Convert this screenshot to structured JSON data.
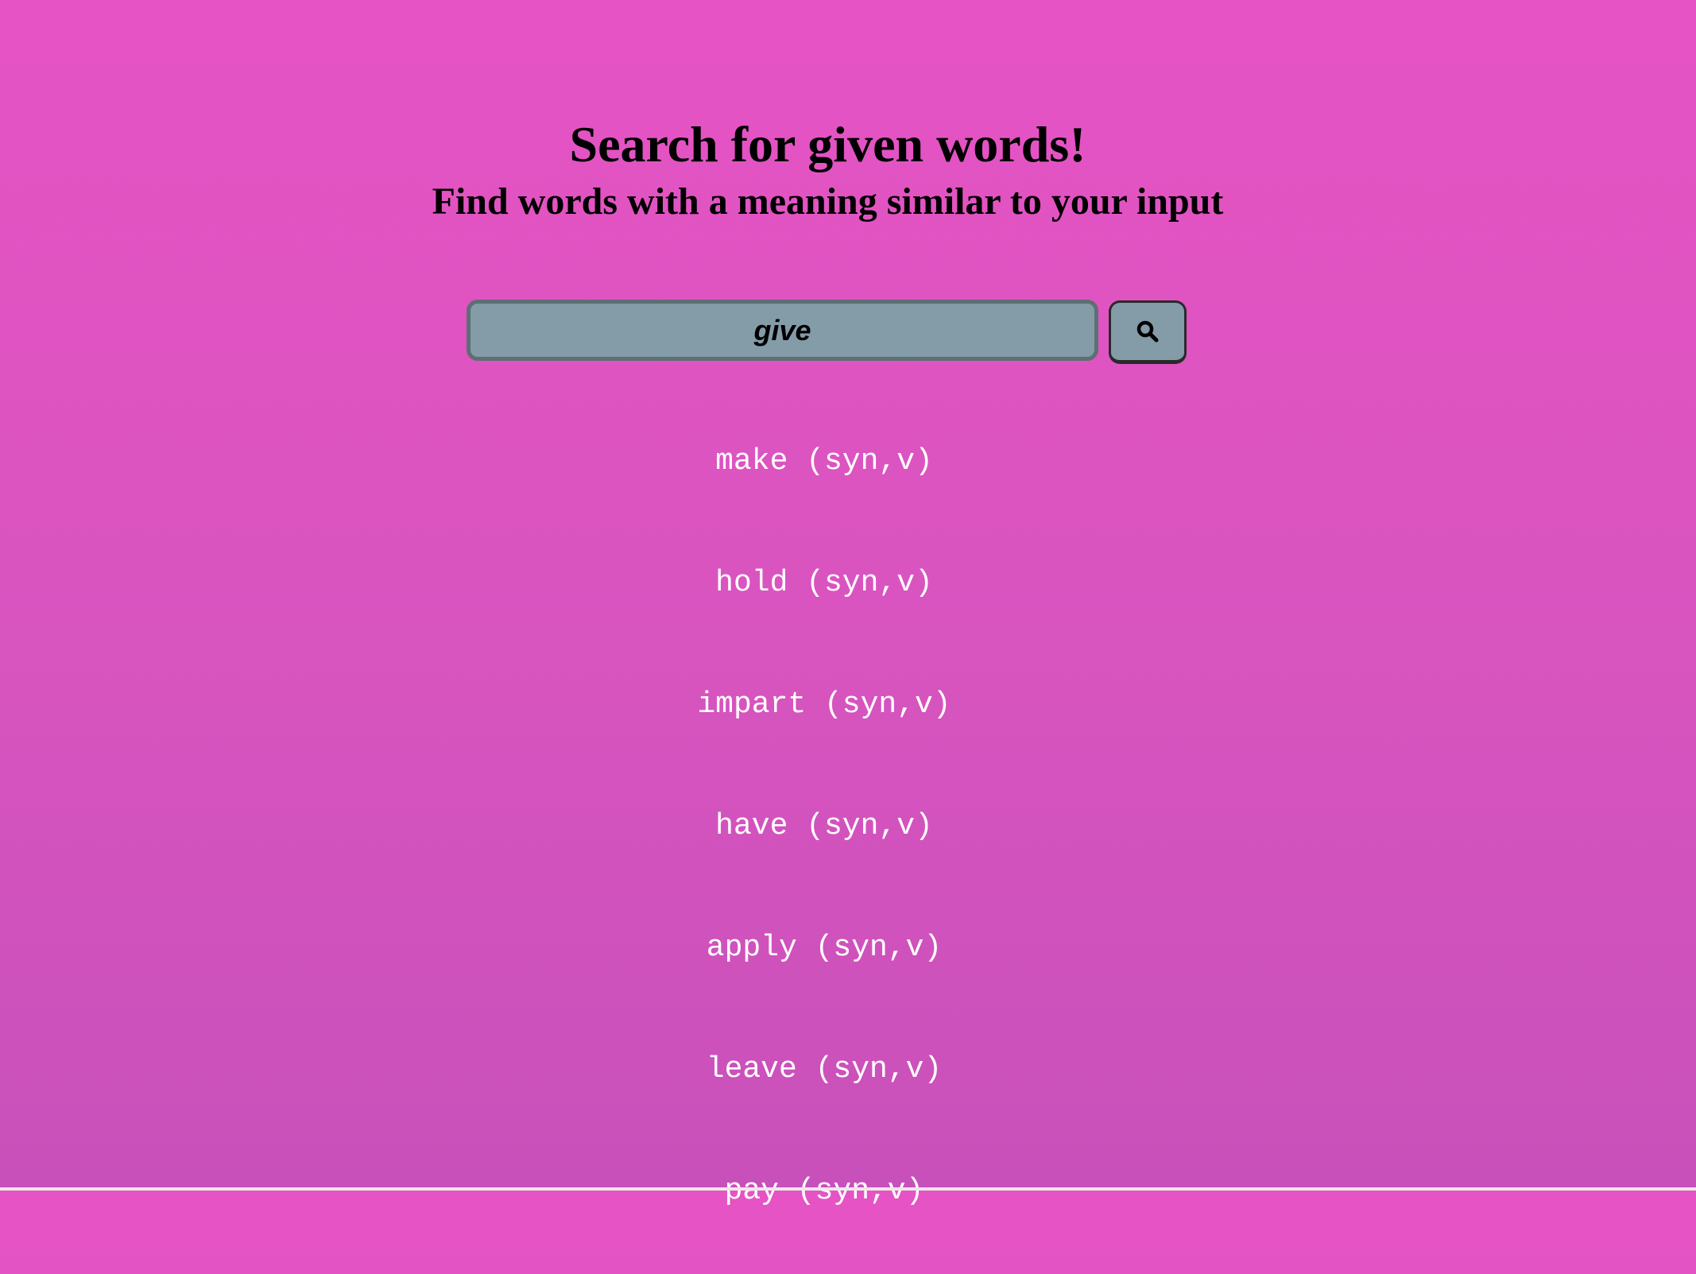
{
  "header": {
    "title": "Search for given words!",
    "subtitle": "Find words with a meaning similar to your input"
  },
  "search": {
    "value": "give",
    "button_icon": "search-icon"
  },
  "results": [
    "make (syn,v)",
    "hold (syn,v)",
    "impart (syn,v)",
    "have (syn,v)",
    "apply (syn,v)",
    "leave (syn,v)",
    "pay (syn,v)"
  ],
  "colors": {
    "background_top": "#e653c4",
    "background_bottom": "#c850ba",
    "input_fill": "#849ba8",
    "input_border": "#5c6f73",
    "result_text": "#ffffff"
  }
}
